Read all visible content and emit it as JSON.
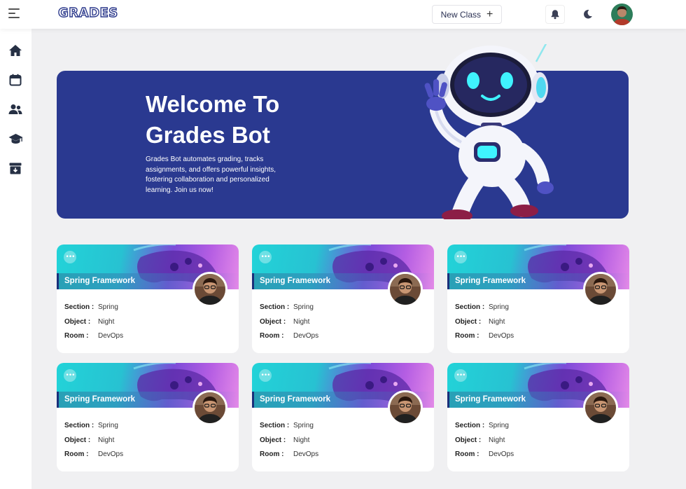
{
  "app": {
    "logo": "GRADES"
  },
  "header": {
    "new_class_label": "New Class",
    "icons": [
      "menu-icon",
      "bell-icon",
      "moon-icon",
      "user-avatar"
    ]
  },
  "sidebar": {
    "items": [
      {
        "icon": "home-icon"
      },
      {
        "icon": "calendar-icon"
      },
      {
        "icon": "users-icon"
      },
      {
        "icon": "graduation-cap-icon"
      },
      {
        "icon": "archive-icon"
      }
    ]
  },
  "hero": {
    "title_line1": "Welcome To",
    "title_line2": "Grades Bot",
    "description": "Grades Bot automates grading, tracks assignments, and offers powerful insights, fostering collaboration and personalized learning. Join us now!"
  },
  "colors": {
    "primary": "#2a3990",
    "accent_cyan": "#22d3d8",
    "accent_purple": "#b55ee3"
  },
  "cards": [
    {
      "name": "Spring Framework",
      "section_key": "Section :",
      "section": "Spring",
      "object_key": "Object :",
      "object": "Night",
      "room_key": "Room   :",
      "room": "DevOps"
    },
    {
      "name": "Spring Framework",
      "section_key": "Section :",
      "section": "Spring",
      "object_key": "Object :",
      "object": "Night",
      "room_key": "Room   :",
      "room": "DevOps"
    },
    {
      "name": "Spring Framework",
      "section_key": "Section :",
      "section": "Spring",
      "object_key": "Object :",
      "object": "Night",
      "room_key": "Room   :",
      "room": "DevOps"
    },
    {
      "name": "Spring Framework",
      "section_key": "Section :",
      "section": "Spring",
      "object_key": "Object :",
      "object": "Night",
      "room_key": "Room   :",
      "room": "DevOps"
    },
    {
      "name": "Spring Framework",
      "section_key": "Section :",
      "section": "Spring",
      "object_key": "Object :",
      "object": "Night",
      "room_key": "Room   :",
      "room": "DevOps"
    },
    {
      "name": "Spring Framework",
      "section_key": "Section :",
      "section": "Spring",
      "object_key": "Object :",
      "object": "Night",
      "room_key": "Room   :",
      "room": "DevOps"
    }
  ]
}
